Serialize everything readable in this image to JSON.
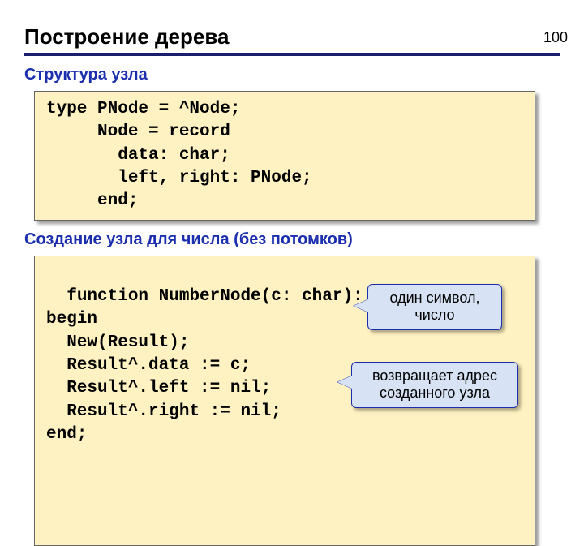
{
  "page_number": "100",
  "title": "Построение дерева",
  "section1_heading": "Структура узла",
  "code1": "type PNode = ^Node;\n     Node = record\n       data: char;\n       left, right: PNode;\n     end;",
  "section2_heading": "Создание узла для числа (без потомков)",
  "code2": "function NumberNode(c: char): PNode;\nbegin\n  New(Result);\n  Result^.data := c;\n  Result^.left := nil;\n  Result^.right := nil;\nend;",
  "callout1": "один символ, число",
  "callout2": "возвращает адрес созданного узла"
}
